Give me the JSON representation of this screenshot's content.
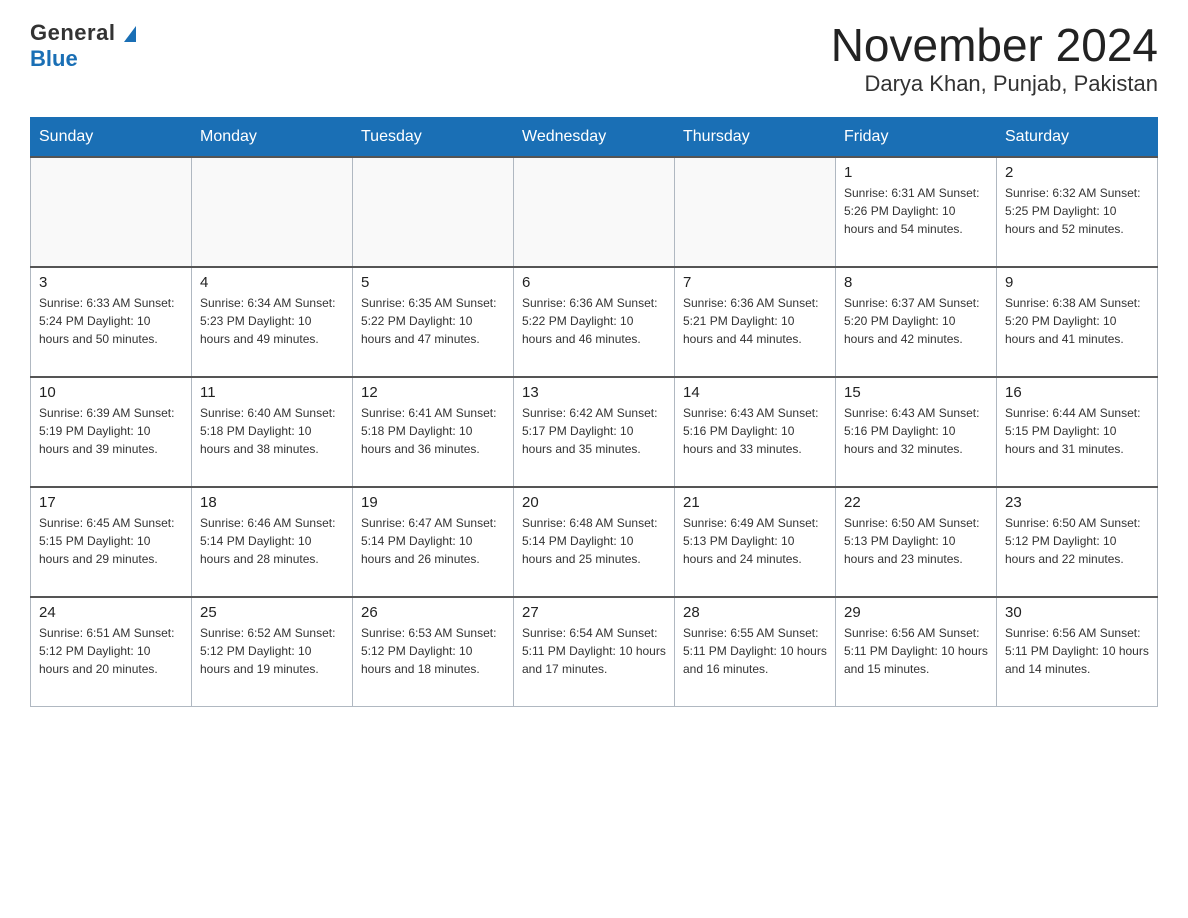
{
  "logo": {
    "general": "General",
    "blue": "Blue"
  },
  "title": "November 2024",
  "subtitle": "Darya Khan, Punjab, Pakistan",
  "weekdays": [
    "Sunday",
    "Monday",
    "Tuesday",
    "Wednesday",
    "Thursday",
    "Friday",
    "Saturday"
  ],
  "weeks": [
    [
      {
        "day": "",
        "info": ""
      },
      {
        "day": "",
        "info": ""
      },
      {
        "day": "",
        "info": ""
      },
      {
        "day": "",
        "info": ""
      },
      {
        "day": "",
        "info": ""
      },
      {
        "day": "1",
        "info": "Sunrise: 6:31 AM\nSunset: 5:26 PM\nDaylight: 10 hours and 54 minutes."
      },
      {
        "day": "2",
        "info": "Sunrise: 6:32 AM\nSunset: 5:25 PM\nDaylight: 10 hours and 52 minutes."
      }
    ],
    [
      {
        "day": "3",
        "info": "Sunrise: 6:33 AM\nSunset: 5:24 PM\nDaylight: 10 hours and 50 minutes."
      },
      {
        "day": "4",
        "info": "Sunrise: 6:34 AM\nSunset: 5:23 PM\nDaylight: 10 hours and 49 minutes."
      },
      {
        "day": "5",
        "info": "Sunrise: 6:35 AM\nSunset: 5:22 PM\nDaylight: 10 hours and 47 minutes."
      },
      {
        "day": "6",
        "info": "Sunrise: 6:36 AM\nSunset: 5:22 PM\nDaylight: 10 hours and 46 minutes."
      },
      {
        "day": "7",
        "info": "Sunrise: 6:36 AM\nSunset: 5:21 PM\nDaylight: 10 hours and 44 minutes."
      },
      {
        "day": "8",
        "info": "Sunrise: 6:37 AM\nSunset: 5:20 PM\nDaylight: 10 hours and 42 minutes."
      },
      {
        "day": "9",
        "info": "Sunrise: 6:38 AM\nSunset: 5:20 PM\nDaylight: 10 hours and 41 minutes."
      }
    ],
    [
      {
        "day": "10",
        "info": "Sunrise: 6:39 AM\nSunset: 5:19 PM\nDaylight: 10 hours and 39 minutes."
      },
      {
        "day": "11",
        "info": "Sunrise: 6:40 AM\nSunset: 5:18 PM\nDaylight: 10 hours and 38 minutes."
      },
      {
        "day": "12",
        "info": "Sunrise: 6:41 AM\nSunset: 5:18 PM\nDaylight: 10 hours and 36 minutes."
      },
      {
        "day": "13",
        "info": "Sunrise: 6:42 AM\nSunset: 5:17 PM\nDaylight: 10 hours and 35 minutes."
      },
      {
        "day": "14",
        "info": "Sunrise: 6:43 AM\nSunset: 5:16 PM\nDaylight: 10 hours and 33 minutes."
      },
      {
        "day": "15",
        "info": "Sunrise: 6:43 AM\nSunset: 5:16 PM\nDaylight: 10 hours and 32 minutes."
      },
      {
        "day": "16",
        "info": "Sunrise: 6:44 AM\nSunset: 5:15 PM\nDaylight: 10 hours and 31 minutes."
      }
    ],
    [
      {
        "day": "17",
        "info": "Sunrise: 6:45 AM\nSunset: 5:15 PM\nDaylight: 10 hours and 29 minutes."
      },
      {
        "day": "18",
        "info": "Sunrise: 6:46 AM\nSunset: 5:14 PM\nDaylight: 10 hours and 28 minutes."
      },
      {
        "day": "19",
        "info": "Sunrise: 6:47 AM\nSunset: 5:14 PM\nDaylight: 10 hours and 26 minutes."
      },
      {
        "day": "20",
        "info": "Sunrise: 6:48 AM\nSunset: 5:14 PM\nDaylight: 10 hours and 25 minutes."
      },
      {
        "day": "21",
        "info": "Sunrise: 6:49 AM\nSunset: 5:13 PM\nDaylight: 10 hours and 24 minutes."
      },
      {
        "day": "22",
        "info": "Sunrise: 6:50 AM\nSunset: 5:13 PM\nDaylight: 10 hours and 23 minutes."
      },
      {
        "day": "23",
        "info": "Sunrise: 6:50 AM\nSunset: 5:12 PM\nDaylight: 10 hours and 22 minutes."
      }
    ],
    [
      {
        "day": "24",
        "info": "Sunrise: 6:51 AM\nSunset: 5:12 PM\nDaylight: 10 hours and 20 minutes."
      },
      {
        "day": "25",
        "info": "Sunrise: 6:52 AM\nSunset: 5:12 PM\nDaylight: 10 hours and 19 minutes."
      },
      {
        "day": "26",
        "info": "Sunrise: 6:53 AM\nSunset: 5:12 PM\nDaylight: 10 hours and 18 minutes."
      },
      {
        "day": "27",
        "info": "Sunrise: 6:54 AM\nSunset: 5:11 PM\nDaylight: 10 hours and 17 minutes."
      },
      {
        "day": "28",
        "info": "Sunrise: 6:55 AM\nSunset: 5:11 PM\nDaylight: 10 hours and 16 minutes."
      },
      {
        "day": "29",
        "info": "Sunrise: 6:56 AM\nSunset: 5:11 PM\nDaylight: 10 hours and 15 minutes."
      },
      {
        "day": "30",
        "info": "Sunrise: 6:56 AM\nSunset: 5:11 PM\nDaylight: 10 hours and 14 minutes."
      }
    ]
  ]
}
